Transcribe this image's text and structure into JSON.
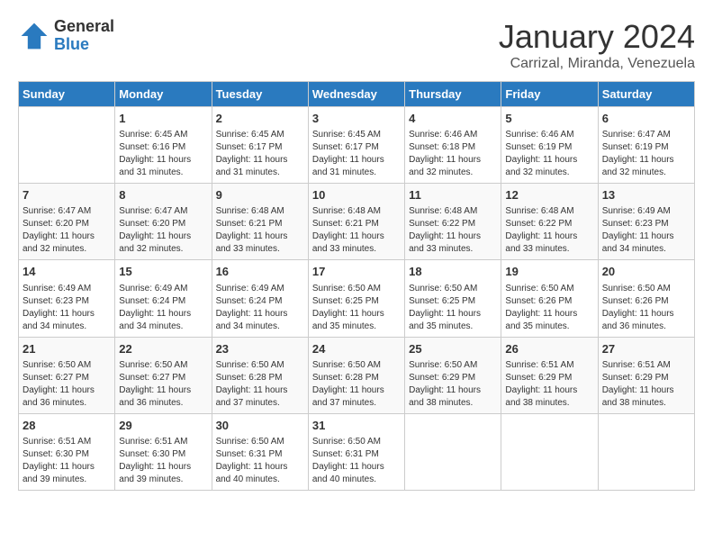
{
  "header": {
    "logo_general": "General",
    "logo_blue": "Blue",
    "month_title": "January 2024",
    "location": "Carrizal, Miranda, Venezuela"
  },
  "days_of_week": [
    "Sunday",
    "Monday",
    "Tuesday",
    "Wednesday",
    "Thursday",
    "Friday",
    "Saturday"
  ],
  "weeks": [
    [
      {
        "day": "",
        "info": ""
      },
      {
        "day": "1",
        "info": "Sunrise: 6:45 AM\nSunset: 6:16 PM\nDaylight: 11 hours\nand 31 minutes."
      },
      {
        "day": "2",
        "info": "Sunrise: 6:45 AM\nSunset: 6:17 PM\nDaylight: 11 hours\nand 31 minutes."
      },
      {
        "day": "3",
        "info": "Sunrise: 6:45 AM\nSunset: 6:17 PM\nDaylight: 11 hours\nand 31 minutes."
      },
      {
        "day": "4",
        "info": "Sunrise: 6:46 AM\nSunset: 6:18 PM\nDaylight: 11 hours\nand 32 minutes."
      },
      {
        "day": "5",
        "info": "Sunrise: 6:46 AM\nSunset: 6:19 PM\nDaylight: 11 hours\nand 32 minutes."
      },
      {
        "day": "6",
        "info": "Sunrise: 6:47 AM\nSunset: 6:19 PM\nDaylight: 11 hours\nand 32 minutes."
      }
    ],
    [
      {
        "day": "7",
        "info": "Sunrise: 6:47 AM\nSunset: 6:20 PM\nDaylight: 11 hours\nand 32 minutes."
      },
      {
        "day": "8",
        "info": "Sunrise: 6:47 AM\nSunset: 6:20 PM\nDaylight: 11 hours\nand 32 minutes."
      },
      {
        "day": "9",
        "info": "Sunrise: 6:48 AM\nSunset: 6:21 PM\nDaylight: 11 hours\nand 33 minutes."
      },
      {
        "day": "10",
        "info": "Sunrise: 6:48 AM\nSunset: 6:21 PM\nDaylight: 11 hours\nand 33 minutes."
      },
      {
        "day": "11",
        "info": "Sunrise: 6:48 AM\nSunset: 6:22 PM\nDaylight: 11 hours\nand 33 minutes."
      },
      {
        "day": "12",
        "info": "Sunrise: 6:48 AM\nSunset: 6:22 PM\nDaylight: 11 hours\nand 33 minutes."
      },
      {
        "day": "13",
        "info": "Sunrise: 6:49 AM\nSunset: 6:23 PM\nDaylight: 11 hours\nand 34 minutes."
      }
    ],
    [
      {
        "day": "14",
        "info": "Sunrise: 6:49 AM\nSunset: 6:23 PM\nDaylight: 11 hours\nand 34 minutes."
      },
      {
        "day": "15",
        "info": "Sunrise: 6:49 AM\nSunset: 6:24 PM\nDaylight: 11 hours\nand 34 minutes."
      },
      {
        "day": "16",
        "info": "Sunrise: 6:49 AM\nSunset: 6:24 PM\nDaylight: 11 hours\nand 34 minutes."
      },
      {
        "day": "17",
        "info": "Sunrise: 6:50 AM\nSunset: 6:25 PM\nDaylight: 11 hours\nand 35 minutes."
      },
      {
        "day": "18",
        "info": "Sunrise: 6:50 AM\nSunset: 6:25 PM\nDaylight: 11 hours\nand 35 minutes."
      },
      {
        "day": "19",
        "info": "Sunrise: 6:50 AM\nSunset: 6:26 PM\nDaylight: 11 hours\nand 35 minutes."
      },
      {
        "day": "20",
        "info": "Sunrise: 6:50 AM\nSunset: 6:26 PM\nDaylight: 11 hours\nand 36 minutes."
      }
    ],
    [
      {
        "day": "21",
        "info": "Sunrise: 6:50 AM\nSunset: 6:27 PM\nDaylight: 11 hours\nand 36 minutes."
      },
      {
        "day": "22",
        "info": "Sunrise: 6:50 AM\nSunset: 6:27 PM\nDaylight: 11 hours\nand 36 minutes."
      },
      {
        "day": "23",
        "info": "Sunrise: 6:50 AM\nSunset: 6:28 PM\nDaylight: 11 hours\nand 37 minutes."
      },
      {
        "day": "24",
        "info": "Sunrise: 6:50 AM\nSunset: 6:28 PM\nDaylight: 11 hours\nand 37 minutes."
      },
      {
        "day": "25",
        "info": "Sunrise: 6:50 AM\nSunset: 6:29 PM\nDaylight: 11 hours\nand 38 minutes."
      },
      {
        "day": "26",
        "info": "Sunrise: 6:51 AM\nSunset: 6:29 PM\nDaylight: 11 hours\nand 38 minutes."
      },
      {
        "day": "27",
        "info": "Sunrise: 6:51 AM\nSunset: 6:29 PM\nDaylight: 11 hours\nand 38 minutes."
      }
    ],
    [
      {
        "day": "28",
        "info": "Sunrise: 6:51 AM\nSunset: 6:30 PM\nDaylight: 11 hours\nand 39 minutes."
      },
      {
        "day": "29",
        "info": "Sunrise: 6:51 AM\nSunset: 6:30 PM\nDaylight: 11 hours\nand 39 minutes."
      },
      {
        "day": "30",
        "info": "Sunrise: 6:50 AM\nSunset: 6:31 PM\nDaylight: 11 hours\nand 40 minutes."
      },
      {
        "day": "31",
        "info": "Sunrise: 6:50 AM\nSunset: 6:31 PM\nDaylight: 11 hours\nand 40 minutes."
      },
      {
        "day": "",
        "info": ""
      },
      {
        "day": "",
        "info": ""
      },
      {
        "day": "",
        "info": ""
      }
    ]
  ]
}
